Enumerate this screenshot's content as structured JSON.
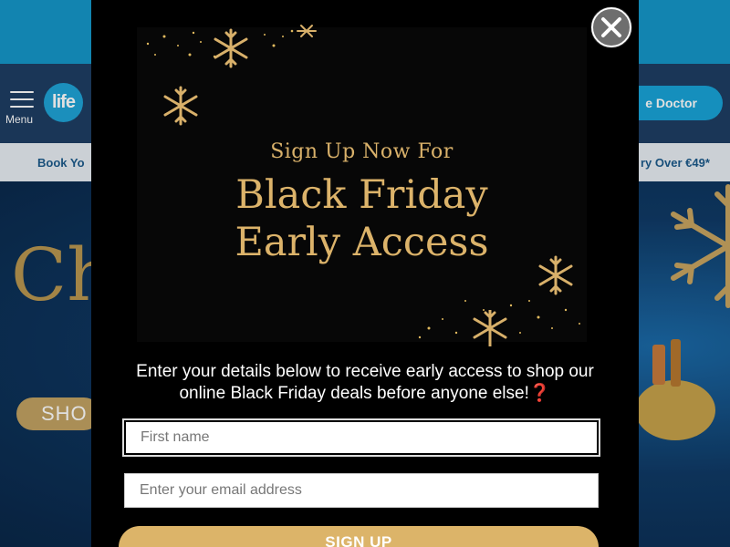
{
  "site": {
    "menu_label": "Menu",
    "logo_text": "life",
    "doctor_button": "e Doctor",
    "promo_left": "Book Yo",
    "promo_right": "ry Over €49*",
    "hero_title": "Ch",
    "shop_button": "SHO",
    "colors": {
      "topbar": "#1597c9",
      "header": "#1e3e63",
      "promo_bg": "#e7edf3",
      "gold": "#c2a262"
    }
  },
  "popup": {
    "close_icon": "close-icon",
    "banner_line1": "Sign Up Now For",
    "banner_line2": "Black Friday",
    "banner_line3": "Early Access",
    "description_line1": "Enter your details below to receive early access to shop our",
    "description_line2": "online Black Friday deals before anyone else!❓",
    "first_name_placeholder": "First name",
    "email_placeholder": "Enter your email address",
    "signup_label": "SIGN UP",
    "colors": {
      "gold": "#dcb469",
      "modal_bg": "#000000"
    }
  }
}
